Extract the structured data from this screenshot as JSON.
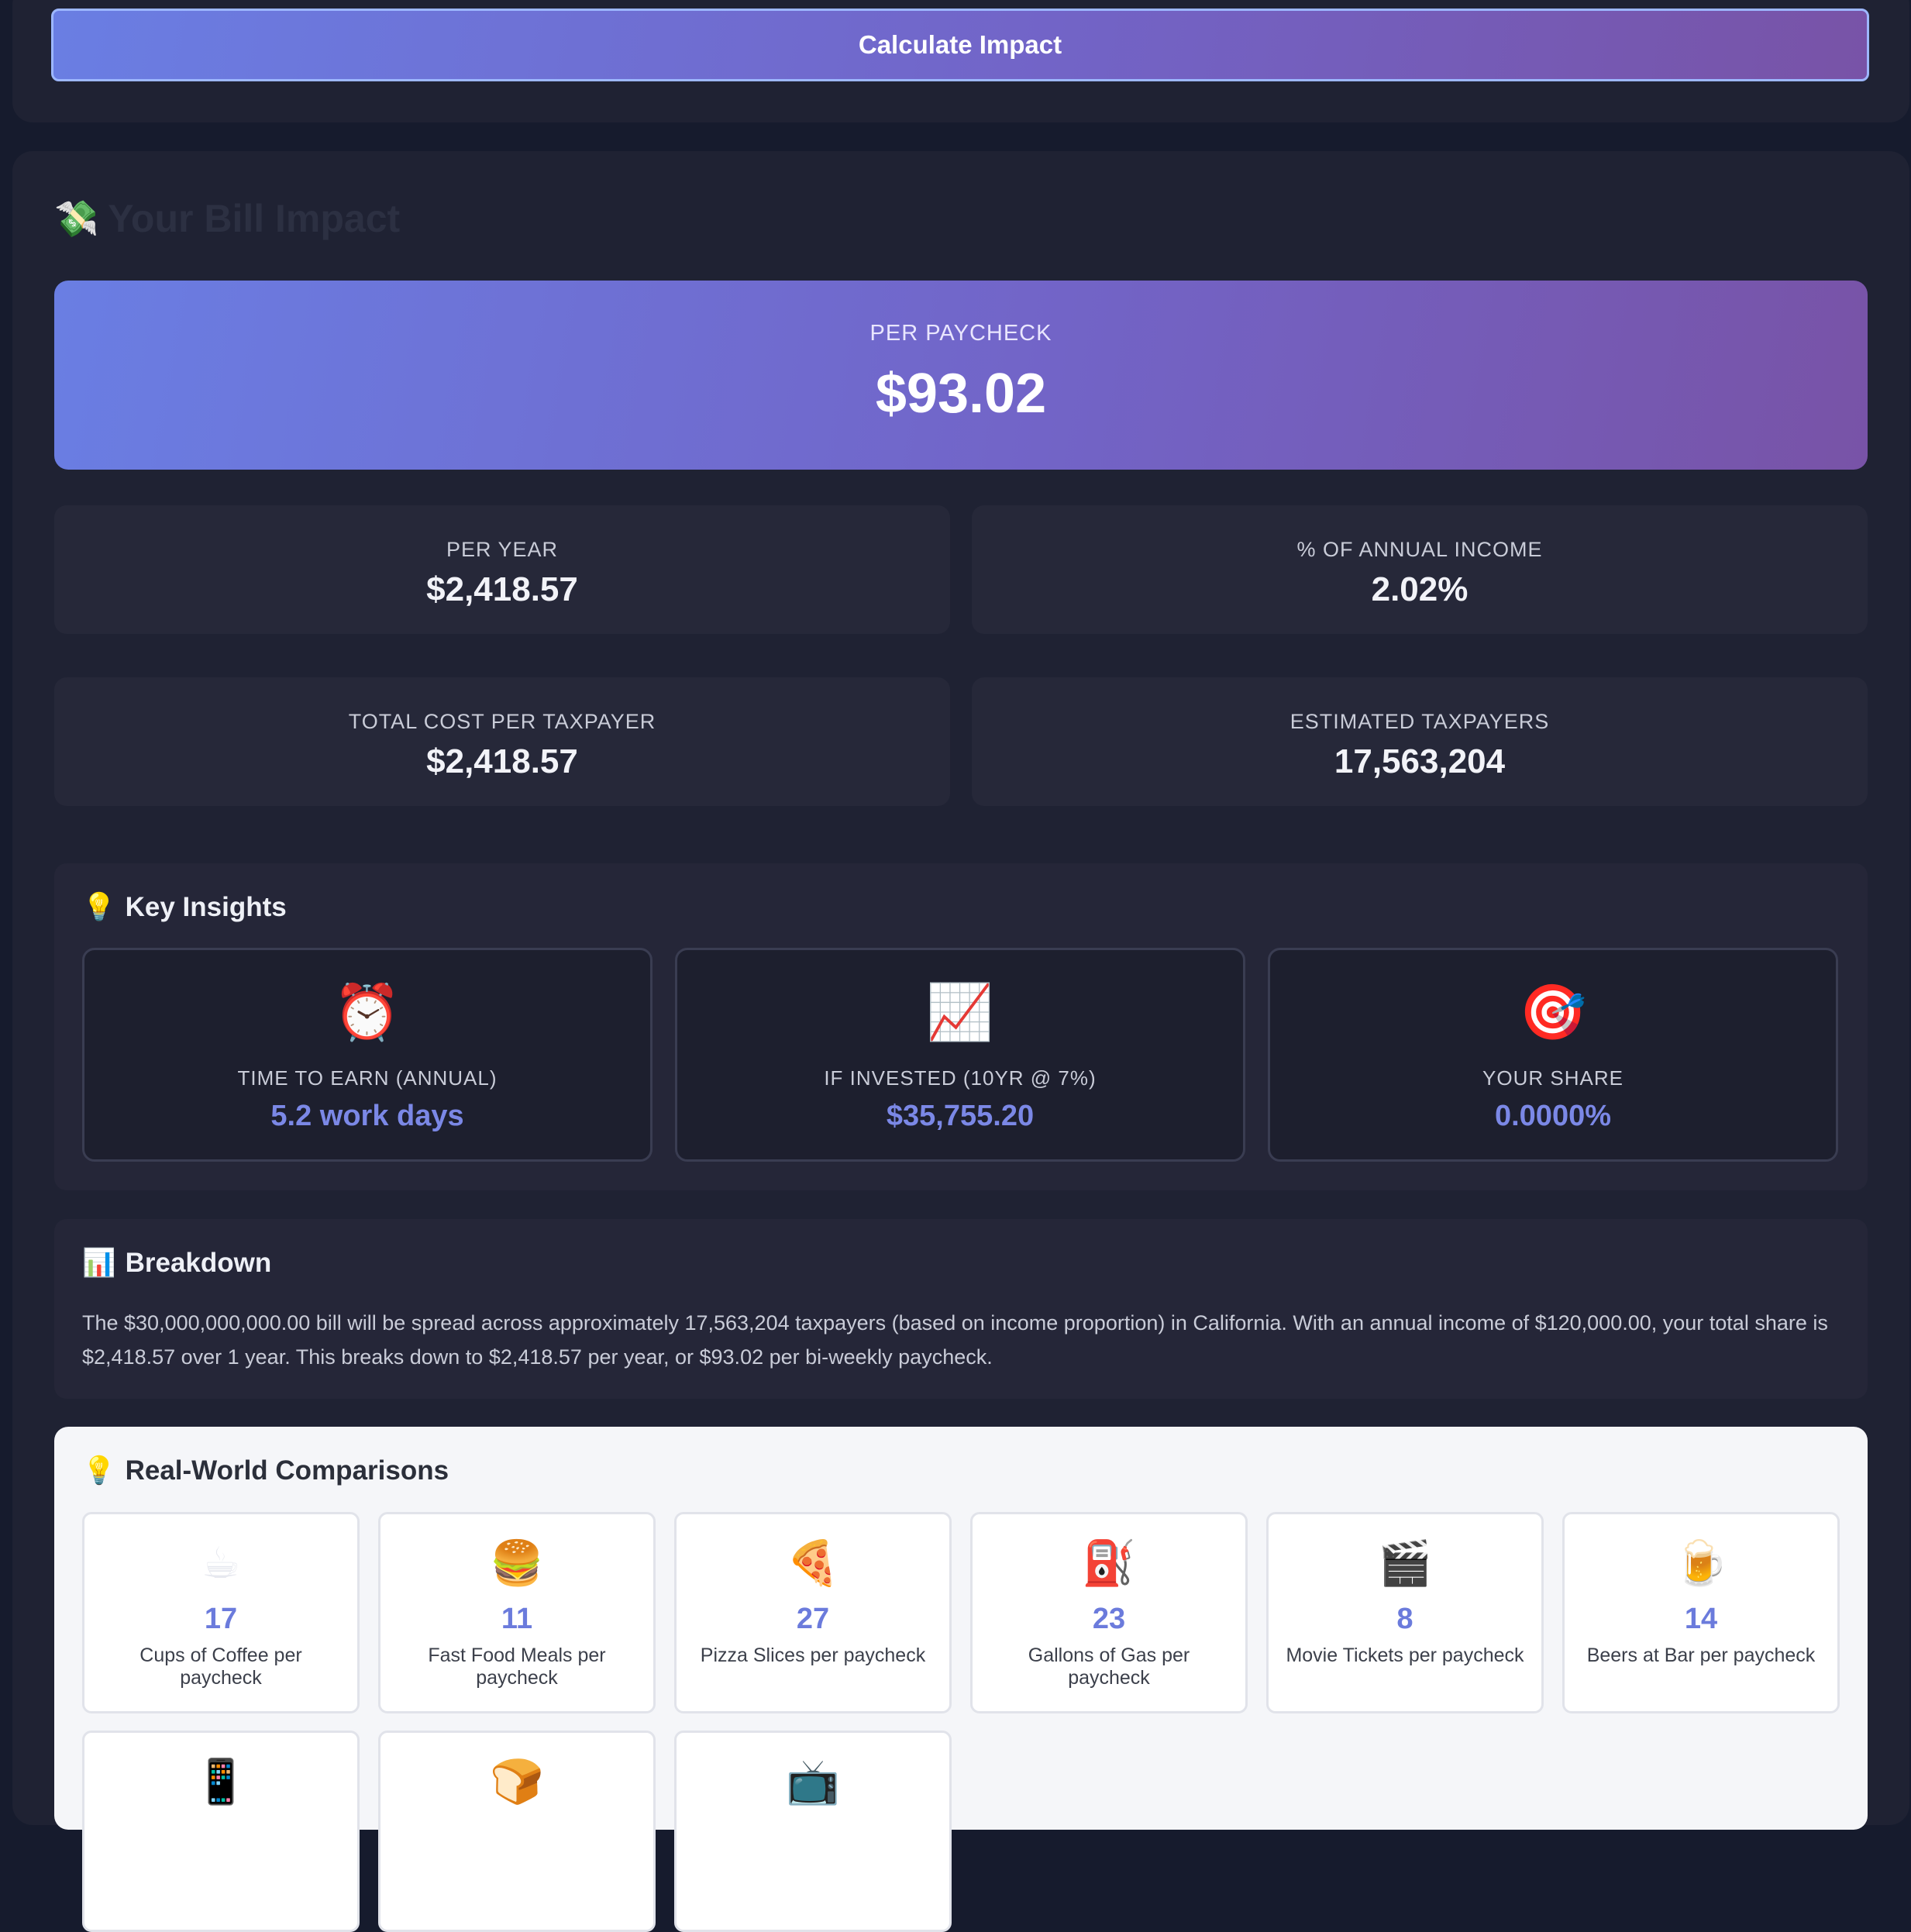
{
  "calculate_button": {
    "label": "Calculate Impact"
  },
  "impact": {
    "icon": "money-with-wings-icon",
    "title": "Your Bill Impact"
  },
  "hero": {
    "label": "PER PAYCHECK",
    "value": "$93.02"
  },
  "stats": [
    {
      "label": "PER YEAR",
      "value": "$2,418.57"
    },
    {
      "label": "% OF ANNUAL INCOME",
      "value": "2.02%"
    },
    {
      "label": "TOTAL COST PER TAXPAYER",
      "value": "$2,418.57"
    },
    {
      "label": "ESTIMATED TAXPAYERS",
      "value": "17,563,204"
    }
  ],
  "insights": {
    "icon": "lightbulb-icon",
    "title": "Key Insights",
    "cards": [
      {
        "icon": "alarm-clock-icon",
        "glyph": "⏰",
        "label": "TIME TO EARN (ANNUAL)",
        "value": "5.2 work days"
      },
      {
        "icon": "chart-increasing-icon",
        "glyph": "📈",
        "label": "IF INVESTED (10YR @ 7%)",
        "value": "$35,755.20"
      },
      {
        "icon": "bullseye-icon",
        "glyph": "🎯",
        "label": "YOUR SHARE",
        "value": "0.0000%"
      }
    ]
  },
  "breakdown": {
    "icon": "bar-chart-icon",
    "title": "Breakdown",
    "text": "The $30,000,000,000.00 bill will be spread across approximately 17,563,204 taxpayers (based on income proportion) in California. With an annual income of $120,000.00, your total share is $2,418.57 over 1 year. This breaks down to $2,418.57 per year, or $93.02 per bi-weekly paycheck."
  },
  "comparisons": {
    "icon": "lightbulb-icon",
    "title": "Real-World Comparisons",
    "items": [
      {
        "icon": "coffee-icon",
        "glyph": "☕",
        "number": "17",
        "label": "Cups of Coffee per paycheck"
      },
      {
        "icon": "hamburger-icon",
        "glyph": "🍔",
        "number": "11",
        "label": "Fast Food Meals per paycheck"
      },
      {
        "icon": "pizza-icon",
        "glyph": "🍕",
        "number": "27",
        "label": "Pizza Slices per paycheck"
      },
      {
        "icon": "fuel-pump-icon",
        "glyph": "⛽",
        "number": "23",
        "label": "Gallons of Gas per paycheck"
      },
      {
        "icon": "clapper-board-icon",
        "glyph": "🎬",
        "number": "8",
        "label": "Movie Tickets per paycheck"
      },
      {
        "icon": "beer-mug-icon",
        "glyph": "🍺",
        "number": "14",
        "label": "Beers at Bar per paycheck"
      },
      {
        "icon": "mobile-phone-icon",
        "glyph": "📱",
        "number": "",
        "label": ""
      },
      {
        "icon": "bread-icon",
        "glyph": "🍞",
        "number": "",
        "label": ""
      },
      {
        "icon": "television-icon",
        "glyph": "📺",
        "number": "",
        "label": ""
      }
    ]
  }
}
